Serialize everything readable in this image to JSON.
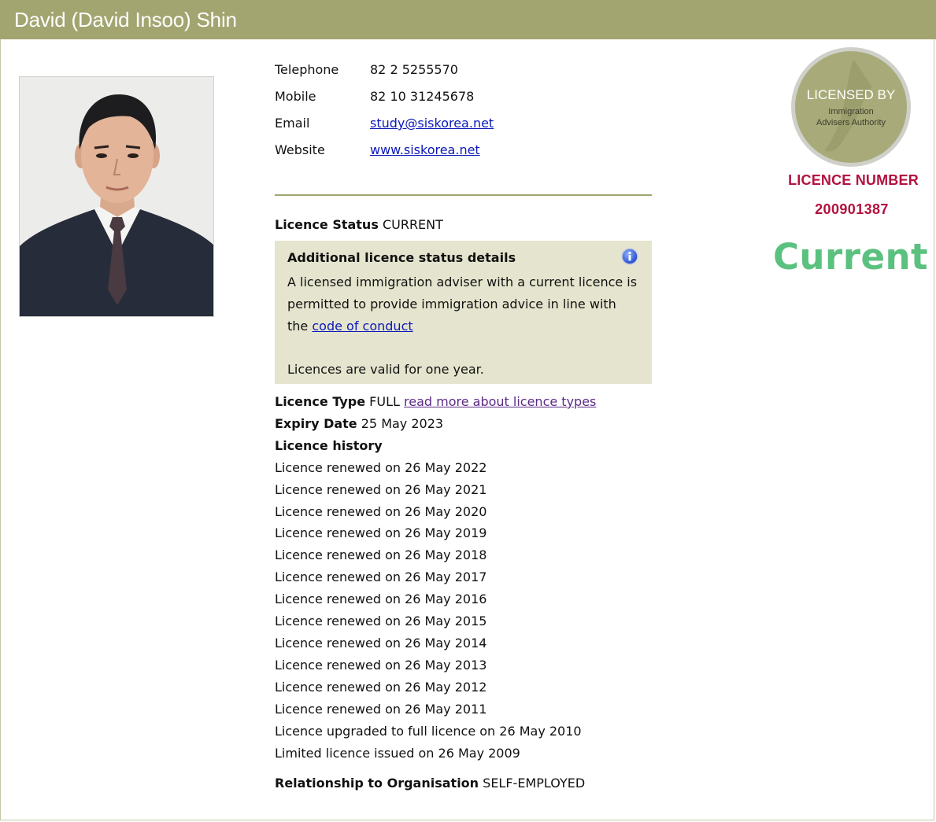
{
  "header": {
    "title": "David (David Insoo) Shin"
  },
  "contact": {
    "telephone_label": "Telephone",
    "telephone": "82 2 5255570",
    "mobile_label": "Mobile",
    "mobile": "82 10 31245678",
    "email_label": "Email",
    "email": "study@siskorea.net",
    "website_label": "Website",
    "website": "www.siskorea.net"
  },
  "licence": {
    "status_label": "Licence Status",
    "status": "CURRENT",
    "info_box": {
      "title": "Additional licence status details",
      "text_pre": "A licensed immigration adviser with a current licence is permitted to provide immigration advice in line with the",
      "link": "code of conduct",
      "validity": "Licences are valid for one year."
    },
    "type_label": "Licence Type",
    "type": "FULL",
    "type_link": "read more about licence types",
    "expiry_label": "Expiry Date",
    "expiry": "25 May 2023",
    "history_label": "Licence history",
    "history": [
      "Licence renewed on 26 May 2022",
      "Licence renewed on 26 May 2021",
      "Licence renewed on 26 May 2020",
      "Licence renewed on 26 May 2019",
      "Licence renewed on 26 May 2018",
      "Licence renewed on 26 May 2017",
      "Licence renewed on 26 May 2016",
      "Licence renewed on 26 May 2015",
      "Licence renewed on 26 May 2014",
      "Licence renewed on 26 May 2013",
      "Licence renewed on 26 May 2012",
      "Licence renewed on 26 May 2011",
      "Licence upgraded to full licence on 26 May 2010",
      "Limited licence issued on 26 May 2009"
    ],
    "relationship_label": "Relationship to Organisation",
    "relationship": "SELF-EMPLOYED"
  },
  "badge": {
    "line1": "LICENSED BY",
    "line2": "Immigration",
    "line3": "Advisers Authority"
  },
  "licence_number_label": "LICENCE NUMBER",
  "licence_number": "200901387",
  "current_big": "Current",
  "colors": {
    "header_bg": "#a2a570",
    "info_box_bg": "#e5e5cf",
    "licence_number": "#b3123f",
    "current": "#5bc17f",
    "link": "#0b18b8"
  },
  "icons": {
    "info": "info-icon",
    "photo": "person-portrait"
  }
}
